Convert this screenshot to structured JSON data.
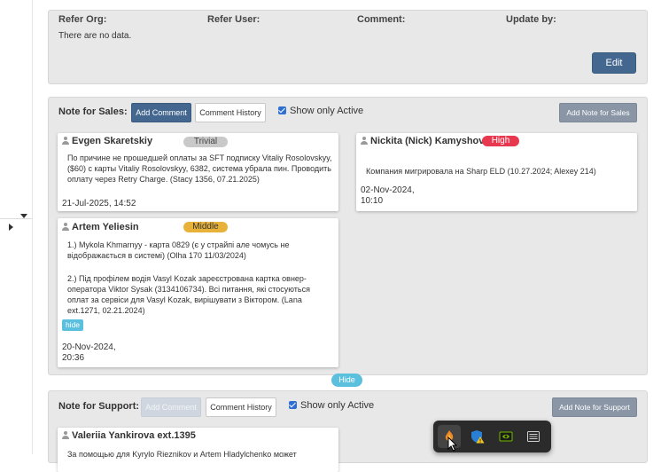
{
  "refer_panel": {
    "headers": [
      "Refer Org:",
      "Refer User:",
      "Comment:",
      "Update by:"
    ],
    "empty_text": "There are no data.",
    "edit_label": "Edit"
  },
  "sales": {
    "label": "Note for Sales:",
    "add_comment": "Add Comment",
    "comment_history": "Comment History",
    "show_only_active": "Show only Active",
    "add_note": "Add Note for Sales",
    "notes": [
      {
        "author": "Evgen Skaretskiy",
        "badge": "Trivial",
        "text": "По причине не прошедшей оплаты за SFT подписку Vitaliy Rosolovskyy, ($60) с карты Vitaliy Rosolovskyy, 6382, система убрала пин. Проводить оплату через Retry Charge. (Stacy 1356, 07.21.2025)",
        "date": "21-Jul-2025, 14:52"
      },
      {
        "author": "Nickita (Nick) Kamyshov",
        "badge": "High",
        "text": "Компания мигрировала на Sharp ELD (10.27.2024; Alexey 214)",
        "date": "02-Nov-2024, 10:10"
      },
      {
        "author": "Artem Yeliesin",
        "badge": "Middle",
        "text1": "1.) Mykola Khmarnyy - карта 0829 (є у страйпі але чомусь не відображається в системі) (Olha 170 11/03/2024)",
        "text2": "2.) Під профілем водія Vasyl Kozak зареєстрована картка овнер-оператора Viktor Sysak (3134106734). Всі питання, які стосуються оплат за сервіси для Vasyl Kozak, вирішувати з Віктором. (Lana ext.1271, 02.21.2024)",
        "hide_label": "hide",
        "date": "20-Nov-2024, 20:36"
      }
    ]
  },
  "hide_toggle": "Hide",
  "support": {
    "label": "Note for Support:",
    "add_comment": "Add Comment",
    "comment_history": "Comment History",
    "show_only_active": "Show only Active",
    "add_note": "Add Note for Support",
    "notes": [
      {
        "author": "Valeriia Yankirova ext.1395",
        "text": "За  помощью для Kyrylo Rieznikov и Artem Hladylchenko может"
      }
    ]
  },
  "tray": {
    "icons": [
      "flame-app-icon",
      "shield-warning-icon",
      "nvidia-icon",
      "keyboard-icon"
    ]
  },
  "colors": {
    "trivial": "#c9c9c9",
    "high": "#e8384f",
    "middle": "#e8b23a",
    "primary": "#44678f",
    "info": "#5bc0de"
  }
}
